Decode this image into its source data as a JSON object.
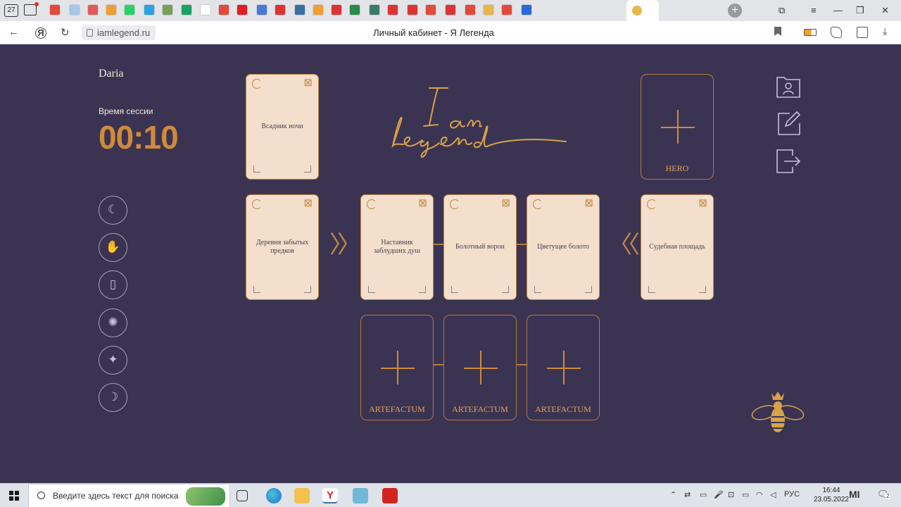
{
  "browser": {
    "tab_count": "27",
    "url": "iamlegend.ru",
    "page_title": "Личный кабинет - Я Легенда",
    "tab_favicon_colors": [
      "#e34a3c",
      "#a6c8e8",
      "#e05a5a",
      "#f0a030",
      "#25d366",
      "#2aa3e0",
      "#78a05a",
      "#1aa260",
      "#ffffff",
      "#e34a3c",
      "#e02020",
      "#4a78d8",
      "#d33",
      "#3a6ea5",
      "#f0a030",
      "#d33",
      "#2a8a4a",
      "#3a7a6a",
      "#d33",
      "#d33",
      "#e34a3c",
      "#d33",
      "#e34a3c",
      "#e8b84a",
      "#e34a3c",
      "#2a6ad8"
    ]
  },
  "user": {
    "name": "Daria",
    "session_label": "Время сессии",
    "session_time": "00:10"
  },
  "sidebar_icons": [
    "hand-moon-icon",
    "hand-star-icon",
    "tarot-cards-icon",
    "book-sun-icon",
    "trash-sparkle-icon",
    "door-moon-icon"
  ],
  "top_card": {
    "title": "Всадник ночи"
  },
  "hero_slot": {
    "label": "HERO"
  },
  "path_cards": [
    {
      "title": "Деревня забытых предков"
    },
    {
      "title": "Наставник заблудших душ"
    },
    {
      "title": "Болотный ворон"
    },
    {
      "title": "Цветущее болото"
    },
    {
      "title": "Судебная площадь"
    }
  ],
  "artefact_slots": [
    {
      "label": "ARTEFACTUM"
    },
    {
      "label": "ARTEFACTUM"
    },
    {
      "label": "ARTEFACTUM"
    }
  ],
  "right_icons": [
    "profile-folder-icon",
    "edit-icon",
    "logout-icon"
  ],
  "taskbar": {
    "search_placeholder": "Введите здесь текст для поиска",
    "language": "РУС",
    "time": "16:44",
    "date": "23.05.2022",
    "notification_count": "2"
  },
  "colors": {
    "background": "#3a3452",
    "accent_gold": "#d08a3c",
    "card_bg": "#f3dfcb"
  }
}
